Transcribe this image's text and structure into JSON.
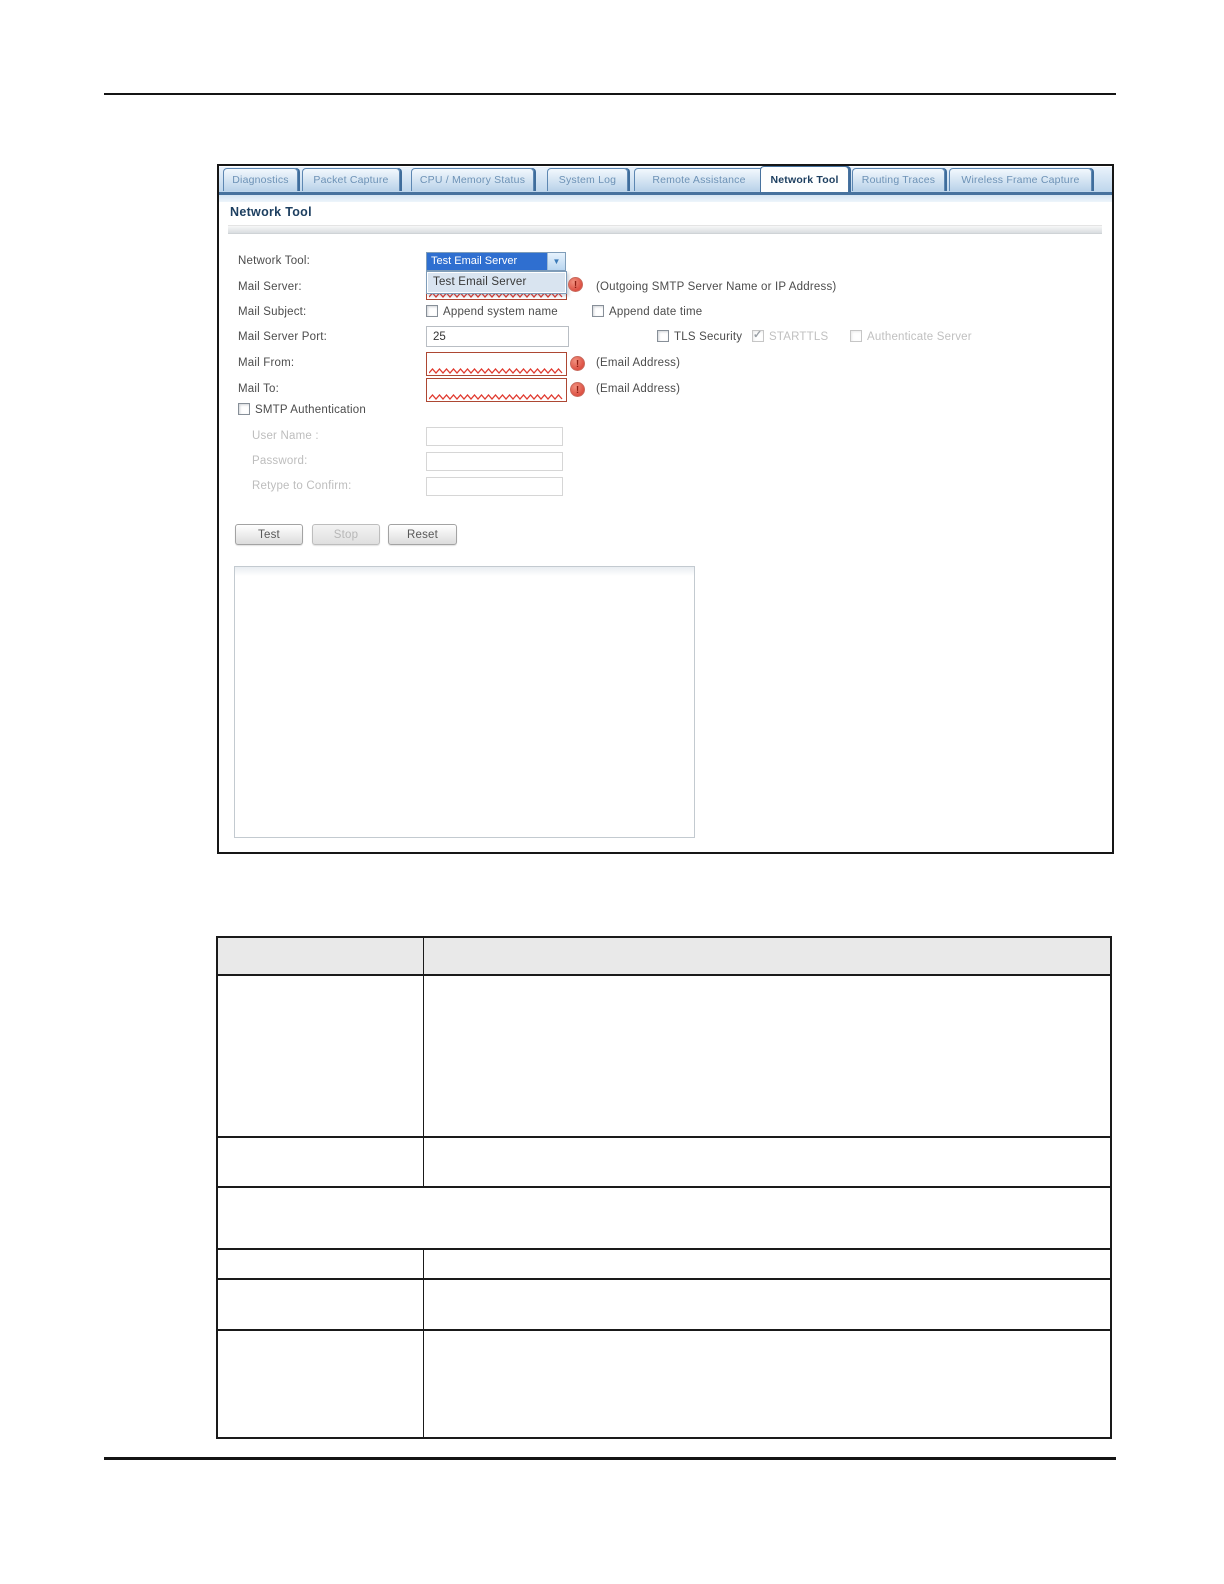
{
  "figure": {
    "tabs": [
      {
        "label": "Diagnostics"
      },
      {
        "label": "Packet Capture"
      },
      {
        "label": "CPU / Memory Status"
      },
      {
        "label": "System Log"
      },
      {
        "label": "Remote Assistance"
      },
      {
        "label": "Network Tool"
      },
      {
        "label": "Routing Traces"
      },
      {
        "label": "Wireless Frame Capture"
      }
    ],
    "active_tab": "Network Tool",
    "section_title": "Network Tool",
    "form": {
      "network_tool_label": "Network Tool:",
      "network_tool_value": "Test Email Server",
      "network_tool_option": "Test Email Server",
      "mail_server_label": "Mail Server:",
      "mail_server_value": "",
      "mail_server_hint": "(Outgoing SMTP Server Name or IP Address)",
      "mail_subject_label": "Mail Subject:",
      "append_system_name_label": "Append system name",
      "append_system_name_checked": false,
      "append_date_time_label": "Append date time",
      "append_date_time_checked": false,
      "mail_server_port_label": "Mail Server Port:",
      "mail_server_port_value": "25",
      "tls_security_label": "TLS Security",
      "tls_security_checked": false,
      "starttls_label": "STARTTLS",
      "starttls_checked": true,
      "starttls_disabled": true,
      "authenticate_server_label": "Authenticate Server",
      "authenticate_server_checked": false,
      "authenticate_server_disabled": true,
      "mail_from_label": "Mail From:",
      "mail_from_value": "",
      "mail_from_hint": "(Email Address)",
      "mail_to_label": "Mail To:",
      "mail_to_value": "",
      "mail_to_hint": "(Email Address)",
      "smtp_authentication_label": "SMTP Authentication",
      "smtp_authentication_checked": false,
      "user_name_label": "User Name :",
      "user_name_value": "",
      "password_label": "Password:",
      "password_value": "",
      "retype_label": "Retype to Confirm:",
      "retype_value": ""
    },
    "buttons": {
      "test": "Test",
      "stop": "Stop",
      "reset": "Reset",
      "stop_disabled": true
    },
    "results_text": ""
  },
  "doc_table": {
    "header": [
      "",
      ""
    ],
    "rows_visible_text": []
  },
  "colors": {
    "tab_active_text": "#1d3f60",
    "tab_inactive_text": "#6d92b6",
    "tab_border": "#47729e",
    "error_red": "#dd5144",
    "error_border": "#ad4733",
    "select_highlight": "#2f6fd0",
    "table_header_bg": "#e9e9e9"
  }
}
